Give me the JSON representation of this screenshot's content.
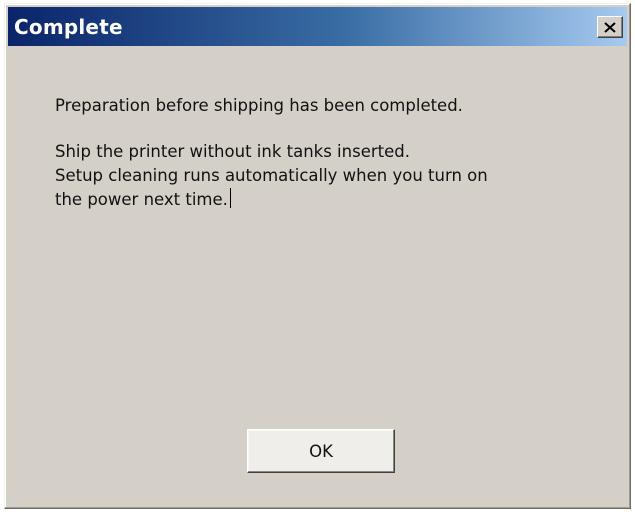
{
  "window": {
    "title": "Complete",
    "close_label": "X"
  },
  "message": {
    "line1": "Preparation before shipping has been completed.",
    "line2": "Ship the printer without ink tanks inserted.",
    "line3": "Setup cleaning runs automatically when you turn on",
    "line4": "the power next time."
  },
  "buttons": {
    "ok_label": "OK"
  },
  "colors": {
    "title_bar_start": "#0a246a",
    "title_bar_end": "#a6caf0",
    "dialog_background": "#d4d0c8"
  }
}
